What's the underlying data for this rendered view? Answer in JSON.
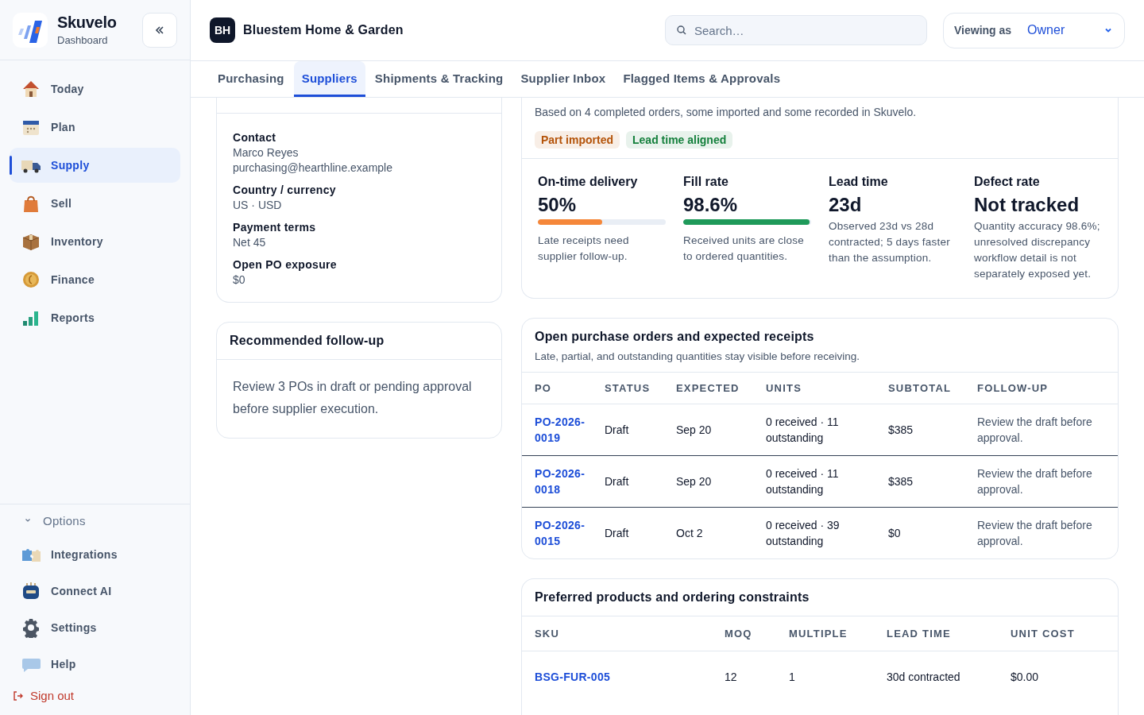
{
  "brand": {
    "name": "Skuvelo",
    "subtitle": "Dashboard"
  },
  "sidebar": {
    "items": [
      {
        "label": "Today",
        "selected": false
      },
      {
        "label": "Plan",
        "selected": false
      },
      {
        "label": "Supply",
        "selected": true
      },
      {
        "label": "Sell",
        "selected": false
      },
      {
        "label": "Inventory",
        "selected": false
      },
      {
        "label": "Finance",
        "selected": false
      },
      {
        "label": "Reports",
        "selected": false
      }
    ],
    "options": {
      "label": "Options",
      "expanded": true,
      "items": [
        {
          "label": "Integrations"
        },
        {
          "label": "Connect AI"
        },
        {
          "label": "Settings"
        },
        {
          "label": "Help"
        }
      ]
    },
    "sign_out": "Sign out"
  },
  "header": {
    "avatar": "BH",
    "store": "Bluestem Home & Garden",
    "search": {
      "placeholder": "Search…"
    },
    "viewing_as": {
      "label": "Viewing as",
      "value": "Owner"
    }
  },
  "tabs": [
    {
      "label": "Purchasing",
      "selected": false
    },
    {
      "label": "Suppliers",
      "selected": true
    },
    {
      "label": "Shipments & Tracking",
      "selected": false
    },
    {
      "label": "Supplier Inbox",
      "selected": false
    },
    {
      "label": "Flagged Items & Approvals",
      "selected": false
    }
  ],
  "supplier_details": {
    "fields": [
      {
        "label": "Contact",
        "values": [
          "Marco Reyes",
          "purchasing@hearthline.example"
        ]
      },
      {
        "label": "Country / currency",
        "values": [
          "US · USD"
        ]
      },
      {
        "label": "Payment terms",
        "values": [
          "Net 45"
        ]
      },
      {
        "label": "Open PO exposure",
        "values": [
          "$0"
        ]
      }
    ]
  },
  "follow_up": {
    "title": "Recommended follow-up",
    "text": "Review 3 POs in draft or pending approval before supplier execution."
  },
  "performance": {
    "subtitle": "Based on 4 completed orders, some imported and some recorded in Skuvelo.",
    "tags": [
      {
        "label": "Part imported",
        "color": "#b45309"
      },
      {
        "label": "Lead time aligned",
        "color": "#15803d"
      }
    ],
    "metrics": [
      {
        "label": "On-time delivery",
        "value": "50%",
        "level": 0.5,
        "color": "#f5873a",
        "note": "Late receipts need supplier follow-up."
      },
      {
        "label": "Fill rate",
        "value": "98.6%",
        "level": 0.986,
        "color": "#1f9a5a",
        "note": "Received units are close to ordered quantities."
      },
      {
        "label": "Lead time",
        "value": "23d",
        "note": "Observed 23d vs 28d contracted; 5 days faster than the assumption."
      },
      {
        "label": "Defect rate",
        "value": "Not tracked",
        "note": "Quantity accuracy 98.6%; unresolved discrepancy workflow detail is not separately exposed yet."
      }
    ]
  },
  "purchase_orders": {
    "title": "Open purchase orders and expected receipts",
    "subtitle": "Late, partial, and outstanding quantities stay visible before receiving.",
    "columns": [
      "PO",
      "STATUS",
      "EXPECTED",
      "UNITS",
      "SUBTOTAL",
      "FOLLOW-UP"
    ],
    "rows": [
      {
        "po": "PO-2026-0019",
        "status": "Draft",
        "expected": "Sep 20",
        "units": "0 received · 11 outstanding",
        "subtotal": "$385",
        "follow_up": "Review the draft before approval."
      },
      {
        "po": "PO-2026-0018",
        "status": "Draft",
        "expected": "Sep 20",
        "units": "0 received · 11 outstanding",
        "subtotal": "$385",
        "follow_up": "Review the draft before approval."
      },
      {
        "po": "PO-2026-0015",
        "status": "Draft",
        "expected": "Oct 2",
        "units": "0 received · 39 outstanding",
        "subtotal": "$0",
        "follow_up": "Review the draft before approval."
      }
    ]
  },
  "products": {
    "title": "Preferred products and ordering constraints",
    "columns": [
      "SKU",
      "MOQ",
      "MULTIPLE",
      "LEAD TIME",
      "UNIT COST"
    ],
    "rows": [
      {
        "sku": "BSG-FUR-005",
        "moq": "12",
        "multiple": "1",
        "lead_time": "30d contracted",
        "unit_cost": "$0.00"
      }
    ]
  }
}
